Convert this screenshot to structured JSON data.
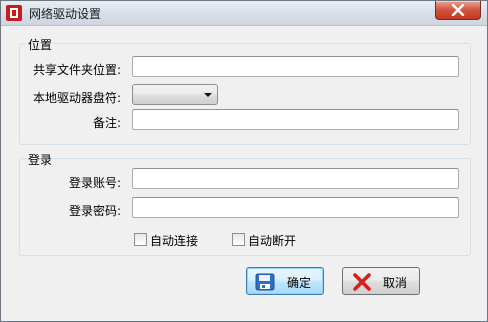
{
  "window": {
    "title": "网络驱动设置",
    "icon": "app-icon",
    "close_icon": "close-icon"
  },
  "location_group": {
    "title": "位置",
    "share_folder_label": "共享文件夹位置:",
    "share_folder_value": "",
    "drive_letter_label": "本地驱动器盘符:",
    "drive_letter_value": "",
    "note_label": "备注:",
    "note_value": ""
  },
  "login_group": {
    "title": "登录",
    "account_label": "登录账号:",
    "account_value": "",
    "password_label": "登录密码:",
    "password_value": "",
    "auto_connect_label": "自动连接",
    "auto_connect_checked": false,
    "auto_disconnect_label": "自动断开",
    "auto_disconnect_checked": false
  },
  "buttons": {
    "ok_label": "确定",
    "ok_icon": "save-icon",
    "cancel_label": "取消",
    "cancel_icon": "red-x-icon"
  },
  "colors": {
    "close_button": "#c13a23",
    "cancel_icon": "#d91e18",
    "save_icon": "#2f6fc2"
  }
}
